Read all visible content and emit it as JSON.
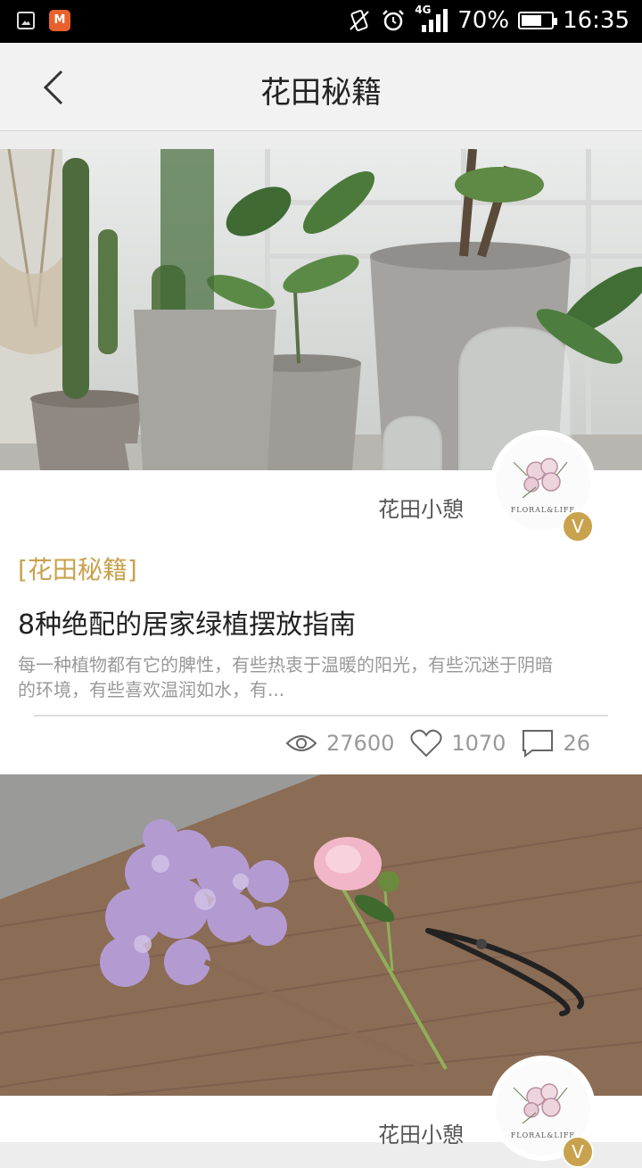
{
  "status_bar": {
    "battery": "70%",
    "battery_level": 0.7,
    "time": "16:35",
    "network": "4G",
    "icons": [
      "gallery-icon",
      "mv-app-icon",
      "vibrate-icon",
      "alarm-icon",
      "signal-icon",
      "battery-icon"
    ]
  },
  "header": {
    "title": "花田秘籍",
    "back_icon": "chevron-left-icon"
  },
  "articles": [
    {
      "image": "potted-cactus-plants-photo",
      "author": "花田小憩",
      "avatar_text": "FLORAL&LIFE",
      "verified_badge": "V",
      "tag": "[花田秘籍]",
      "title": "8种绝配的居家绿植摆放指南",
      "summary": "每一种植物都有它的脾性，有些热衷于温暖的阳光，有些沉迷于阴暗的环境，有些喜欢温润如水，有...",
      "views": "27600",
      "likes": "1070",
      "comments": "26"
    },
    {
      "image": "lilac-peony-shears-photo",
      "author": "花田小憩",
      "avatar_text": "FLORAL&LIFE",
      "verified_badge": "V"
    }
  ],
  "colors": {
    "accent_gold": "#c9a24e",
    "header_bg": "#f2f2f2",
    "status_bg": "#000000"
  }
}
